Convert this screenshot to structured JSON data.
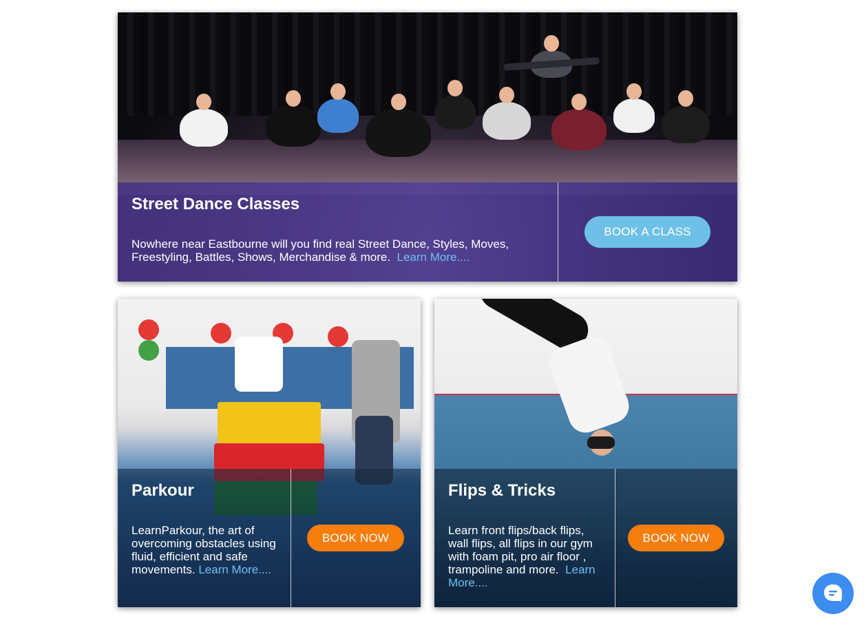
{
  "cards": {
    "street": {
      "title": "Street Dance Classes",
      "text": "Nowhere near Eastbourne will you find real Street Dance, Styles, Moves, Freestyling, Battles, Shows, Merchandise & more.",
      "learn_more": "Learn More....",
      "button": "BOOK A CLASS"
    },
    "parkour": {
      "title": "Parkour",
      "text": "LearnParkour, the art of overcoming obstacles using fluid, efficient and safe movements.",
      "learn_more": "Learn More....",
      "button": "BOOK NOW"
    },
    "flips": {
      "title": "Flips & Tricks",
      "text": "Learn front flips/back flips, wall flips, all flips in our gym with foam pit, pro air floor , trampoline and more.",
      "learn_more": "Learn More....",
      "button": "BOOK NOW"
    }
  },
  "chat": {
    "icon": "chat-icon"
  },
  "colors": {
    "purple_overlay": "#52409a",
    "book_class_button": "#6fc0e6",
    "book_now_button": "#f77d0d",
    "link": "#6ec1f2",
    "chat_button": "#3d8cf0"
  }
}
